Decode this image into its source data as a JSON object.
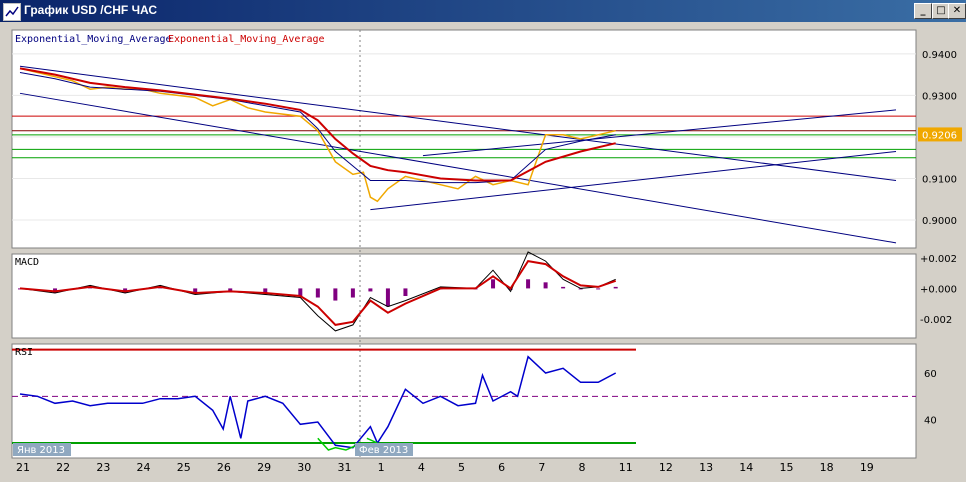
{
  "window": {
    "title": "График USD /CHF ЧАС",
    "buttons": {
      "minimize": "_",
      "maximize": "□",
      "close": "✕"
    }
  },
  "colors": {
    "background": "#ffffff",
    "price": "#f0a800",
    "ema_fast": "#000080",
    "ema_slow": "#cc0000",
    "macd_hist": "#800080",
    "rsi": "#0000cc",
    "rsi_oversold": "#00cc00",
    "level_red": "#cc0000",
    "level_green": "#00a000",
    "level_dark": "#800000",
    "channel": "#000080",
    "current_price_bg": "#f0a800"
  },
  "chart_data": [
    {
      "type": "line",
      "panel": "price",
      "legend": [
        "Exponential_Moving_Average",
        "Exponential_Moving_Average"
      ],
      "ylim": [
        0.8935,
        0.9455
      ],
      "y_ticks": [
        "0.9400",
        "0.9300",
        "0.9200",
        "0.9100",
        "0.9000"
      ],
      "y_tick_values": [
        0.94,
        0.93,
        0.92,
        0.91,
        0.9
      ],
      "current_price": "0.9206",
      "x_index_range": [
        0,
        25
      ],
      "series": [
        {
          "role": "price",
          "x": [
            0,
            0.5,
            1,
            1.5,
            2,
            2.5,
            3,
            3.5,
            4,
            4.5,
            5,
            5.5,
            6,
            6.5,
            7,
            7.5,
            8,
            8.5,
            9,
            9.5,
            9.8,
            10,
            10.2,
            10.5,
            11,
            11.5,
            12,
            12.5,
            13,
            13.5,
            14,
            14.5,
            15,
            15.5,
            16,
            16.5,
            17
          ],
          "values": [
            0.9365,
            0.9355,
            0.9345,
            0.9335,
            0.9315,
            0.932,
            0.9315,
            0.9315,
            0.9305,
            0.93,
            0.9295,
            0.9275,
            0.929,
            0.927,
            0.926,
            0.9255,
            0.925,
            0.9215,
            0.914,
            0.911,
            0.9115,
            0.9055,
            0.9045,
            0.9075,
            0.9105,
            0.9095,
            0.9085,
            0.9075,
            0.9105,
            0.9085,
            0.9095,
            0.9085,
            0.9205,
            0.9205,
            0.9195,
            0.9205,
            0.9215
          ]
        },
        {
          "role": "ema_fast",
          "x": [
            0,
            1,
            2,
            3,
            4,
            5,
            6,
            7,
            8,
            8.5,
            9,
            9.5,
            10,
            10.5,
            11,
            12,
            13,
            14,
            15,
            16,
            17
          ],
          "values": [
            0.9355,
            0.934,
            0.932,
            0.9315,
            0.931,
            0.93,
            0.929,
            0.9275,
            0.926,
            0.922,
            0.9165,
            0.913,
            0.9095,
            0.9095,
            0.9095,
            0.909,
            0.909,
            0.9095,
            0.917,
            0.919,
            0.9205
          ]
        },
        {
          "role": "ema_slow",
          "x": [
            0,
            1,
            2,
            3,
            4,
            5,
            6,
            7,
            8,
            8.5,
            9,
            9.5,
            10,
            10.5,
            11,
            12,
            13,
            14,
            15,
            16,
            17
          ],
          "values": [
            0.9365,
            0.935,
            0.933,
            0.932,
            0.9312,
            0.9302,
            0.9292,
            0.928,
            0.9265,
            0.924,
            0.9195,
            0.916,
            0.913,
            0.912,
            0.9115,
            0.91,
            0.9095,
            0.9095,
            0.914,
            0.9165,
            0.9185
          ]
        }
      ],
      "hlines": [
        {
          "y": 0.925,
          "color": "#cc0000"
        },
        {
          "y": 0.9215,
          "color": "#800000"
        },
        {
          "y": 0.9205,
          "color": "#00a000"
        },
        {
          "y": 0.917,
          "color": "#00a000"
        },
        {
          "y": 0.915,
          "color": "#00a000"
        }
      ],
      "trendlines": [
        {
          "x": [
            0,
            25
          ],
          "y": [
            0.937,
            0.9095
          ]
        },
        {
          "x": [
            0,
            25
          ],
          "y": [
            0.9305,
            0.8945
          ]
        },
        {
          "x": [
            10,
            25
          ],
          "y": [
            0.9025,
            0.9165
          ]
        },
        {
          "x": [
            11.5,
            25
          ],
          "y": [
            0.9155,
            0.9265
          ]
        }
      ]
    },
    {
      "type": "line",
      "panel": "macd",
      "title": "MACD",
      "ylim": [
        -0.0032,
        0.0022
      ],
      "y_ticks": [
        "+0.002",
        "+0.000",
        "-0.002"
      ],
      "y_tick_values": [
        0.002,
        0.0,
        -0.002
      ],
      "x_index_range": [
        0,
        25
      ],
      "series": [
        {
          "role": "macd",
          "x": [
            0,
            1,
            2,
            3,
            4,
            5,
            6,
            7,
            8,
            8.5,
            9,
            9.5,
            10,
            10.5,
            11,
            12,
            13,
            13.5,
            14,
            14.5,
            15,
            15.5,
            16,
            16.5,
            17
          ],
          "values": [
            0.0,
            -0.0003,
            0.0002,
            -0.0003,
            0.0002,
            -0.0004,
            -0.0002,
            -0.0004,
            -0.0006,
            -0.0018,
            -0.0028,
            -0.0024,
            -0.0006,
            -0.0012,
            -0.0008,
            0.0001,
            0.0,
            0.0012,
            -0.0002,
            0.0024,
            0.0018,
            0.0006,
            0.0,
            0.0001,
            0.0006
          ]
        },
        {
          "role": "signal",
          "x": [
            0,
            1,
            2,
            3,
            4,
            5,
            6,
            7,
            8,
            8.5,
            9,
            9.5,
            10,
            10.5,
            11,
            12,
            13,
            13.5,
            14,
            14.5,
            15,
            15.5,
            16,
            16.5,
            17
          ],
          "values": [
            0.0,
            -0.0002,
            0.0001,
            -0.0002,
            0.0001,
            -0.0003,
            -0.0002,
            -0.0003,
            -0.0005,
            -0.0012,
            -0.0024,
            -0.0022,
            -0.0008,
            -0.0016,
            -0.001,
            0.0,
            0.0,
            0.0008,
            0.0,
            0.0018,
            0.0016,
            0.0008,
            0.0002,
            0.0001,
            0.0005
          ]
        }
      ],
      "histogram": {
        "x": [
          0,
          1,
          2,
          3,
          4,
          5,
          6,
          7,
          8,
          8.5,
          9,
          9.5,
          10,
          10.5,
          11,
          12,
          13,
          13.5,
          14,
          14.5,
          15,
          15.5,
          16,
          16.5,
          17
        ],
        "values": [
          0.0,
          -0.0003,
          0.0001,
          -0.0003,
          0.0001,
          -0.0004,
          -0.0002,
          -0.0004,
          -0.0005,
          -0.0006,
          -0.0008,
          -0.0006,
          -0.0002,
          -0.0012,
          -0.0005,
          0.0,
          0.0,
          0.0006,
          -0.0001,
          0.0006,
          0.0004,
          0.0001,
          0.0,
          0.0,
          0.0001
        ]
      }
    },
    {
      "type": "line",
      "panel": "rsi",
      "title": "RSI",
      "ylim": [
        24,
        72
      ],
      "y_ticks": [
        "60",
        "40"
      ],
      "y_tick_values": [
        60,
        40
      ],
      "levels": [
        {
          "y": 70,
          "color": "#cc0000"
        },
        {
          "y": 50,
          "color": "#800080",
          "dashed": true
        },
        {
          "y": 30,
          "color": "#00a000"
        }
      ],
      "x_index_range": [
        0,
        25
      ],
      "series": [
        {
          "role": "rsi",
          "x": [
            0,
            0.5,
            1,
            1.5,
            2,
            2.5,
            3,
            3.5,
            4,
            4.5,
            5,
            5.5,
            5.8,
            6,
            6.3,
            6.5,
            7,
            7.5,
            8,
            8.5,
            9,
            9.5,
            10,
            10.2,
            10.5,
            11,
            11.5,
            12,
            12.5,
            13,
            13.2,
            13.5,
            14,
            14.2,
            14.5,
            15,
            15.5,
            16,
            16.5,
            17
          ],
          "values": [
            51,
            50,
            47,
            48,
            46,
            47,
            47,
            47,
            49,
            49,
            50,
            44,
            36,
            50,
            32,
            48,
            50,
            47,
            38,
            39,
            29,
            28,
            37,
            30,
            37,
            53,
            47,
            50,
            46,
            47,
            59,
            48,
            52,
            50,
            67,
            60,
            62,
            56,
            56,
            60
          ]
        }
      ],
      "oversold_segments": [
        {
          "x": [
            8.5,
            8.8,
            9,
            9.3,
            9.6
          ],
          "values": [
            32,
            27,
            28,
            27,
            29
          ]
        },
        {
          "x": [
            9.9,
            10.2
          ],
          "values": [
            32,
            30
          ]
        }
      ]
    }
  ],
  "x_axis": {
    "labels": [
      "21",
      "22",
      "23",
      "24",
      "25",
      "26",
      "29",
      "30",
      "31",
      "1",
      "4",
      "5",
      "6",
      "7",
      "8",
      "11",
      "12",
      "13",
      "14",
      "15",
      "18",
      "19"
    ],
    "month_labels": [
      {
        "text": "Янв 2013",
        "at": 0
      },
      {
        "text": "Фев 2013",
        "at": 9
      }
    ]
  },
  "panels_text": {
    "ema1": "Exponential_Moving_Average",
    "ema2": "Exponential_Moving_Average",
    "macd": "MACD",
    "rsi": "RSI"
  }
}
